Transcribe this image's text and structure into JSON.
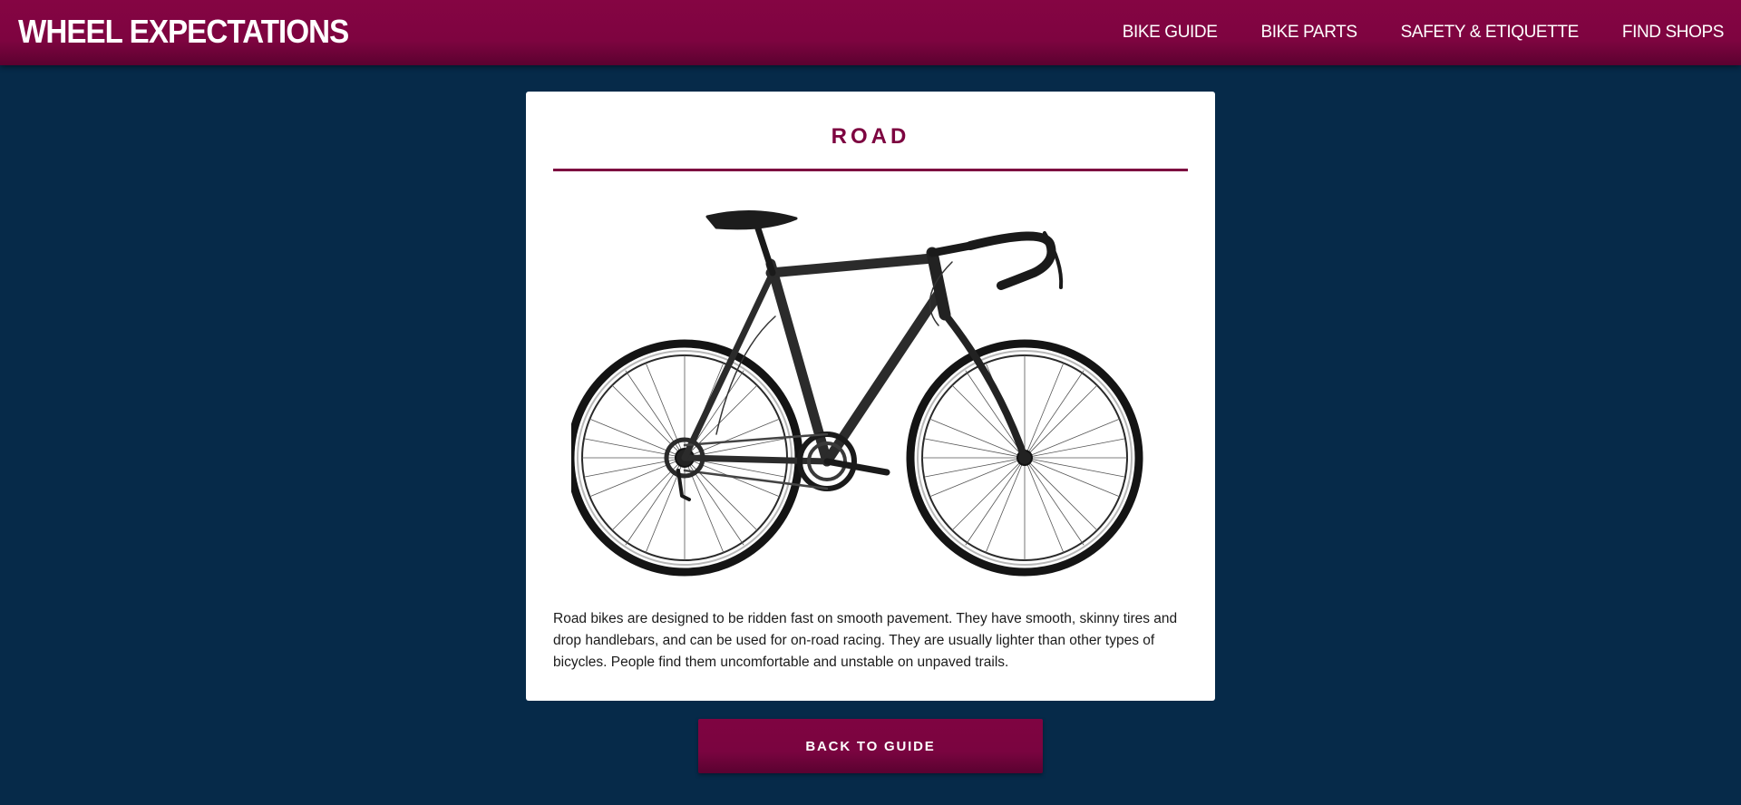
{
  "header": {
    "brand": "WHEEL EXPECTATIONS",
    "nav": [
      {
        "label": "BIKE GUIDE"
      },
      {
        "label": "BIKE PARTS"
      },
      {
        "label": "SAFETY & ETIQUETTE"
      },
      {
        "label": "FIND SHOPS"
      }
    ]
  },
  "card": {
    "title": "ROAD",
    "image_icon": "road-bike-image",
    "description": "Road bikes are designed to be ridden fast on smooth pavement. They have smooth, skinny tires and drop handlebars, and can be used for on-road racing. They are usually lighter than other types of bicycles. People find them uncomfortable and unstable on unpaved trails."
  },
  "back_button": {
    "label": "BACK TO GUIDE"
  },
  "colors": {
    "background": "#062a49",
    "accent": "#7d0440",
    "card": "#ffffff"
  }
}
